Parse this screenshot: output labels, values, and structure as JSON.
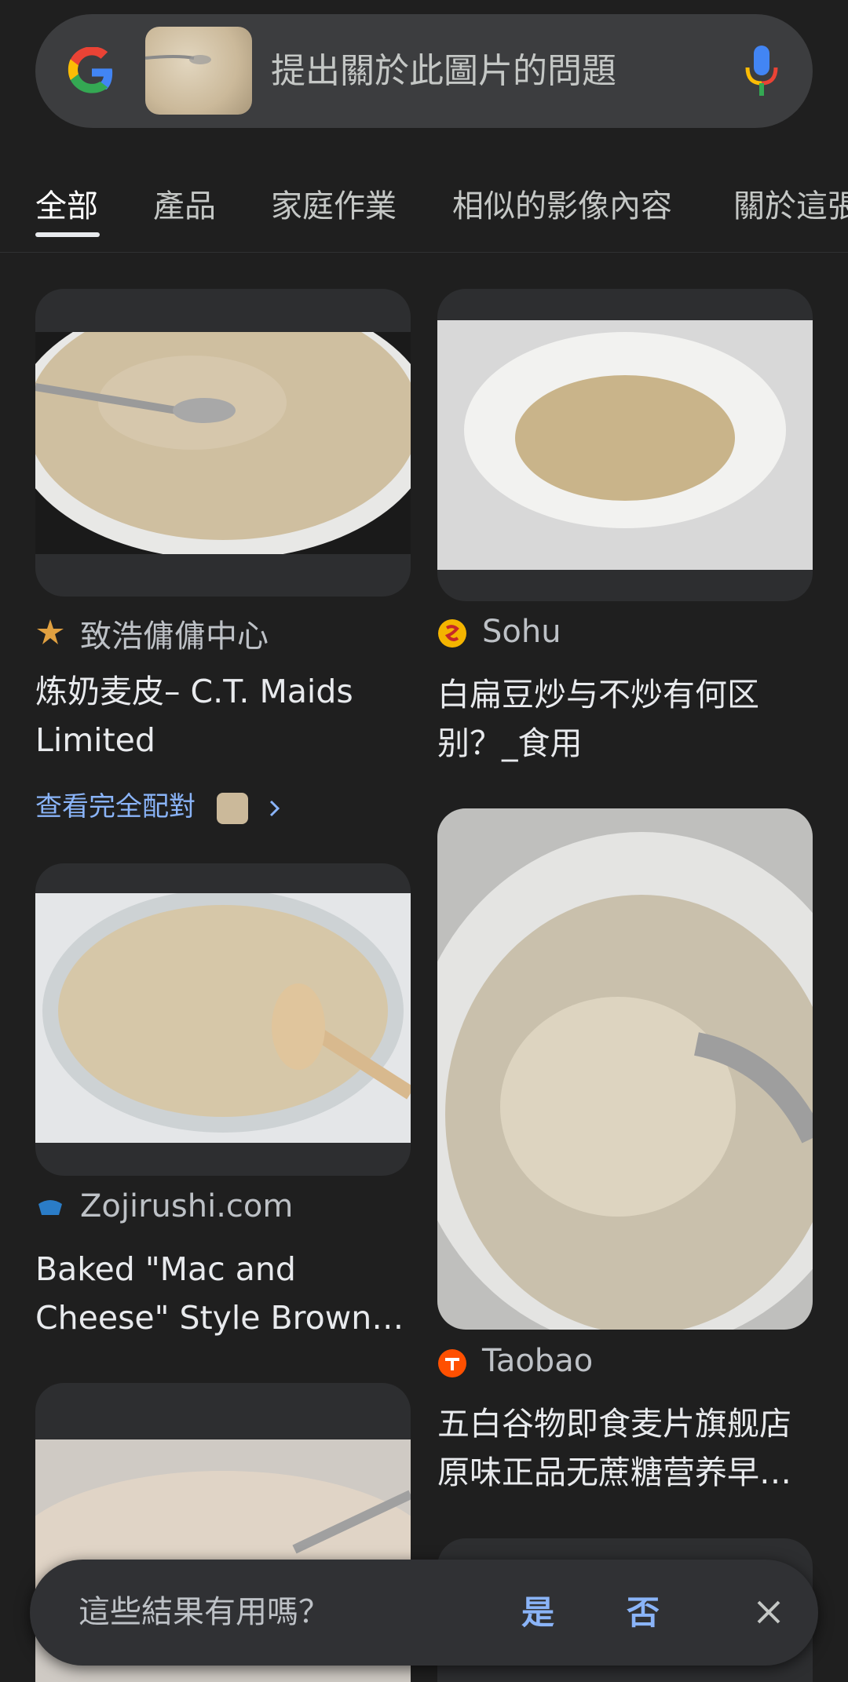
{
  "search": {
    "placeholder": "提出關於此圖片的問題"
  },
  "tabs": [
    {
      "label": "全部",
      "active": true
    },
    {
      "label": "產品"
    },
    {
      "label": "家庭作業"
    },
    {
      "label": "相似的影像內容"
    },
    {
      "label": "關於這張"
    }
  ],
  "results": [
    {
      "source": "致浩傭傭中心",
      "title": "炼奶麦皮– C.T. Maids Limited",
      "match_link": "查看完全配對"
    },
    {
      "source": "Sohu",
      "title": "白扁豆炒与不炒有何区别？_食用"
    },
    {
      "source": "Zojirushi.com",
      "title": "Baked \"Mac and Cheese\" Style Brown…"
    },
    {
      "source": "Taobao",
      "title": "五白谷物即食麦片旗舰店原味正品无蔗糖营养早…"
    }
  ],
  "feedback": {
    "question": "這些結果有用嗎？",
    "yes": "是",
    "no": "否"
  },
  "colors": {
    "background": "#1f1f1f",
    "link": "#8ab4f8",
    "searchbar": "#3c3d3f"
  },
  "icons": [
    "google-logo-icon",
    "mic-icon",
    "chevron-right-icon",
    "close-icon"
  ]
}
